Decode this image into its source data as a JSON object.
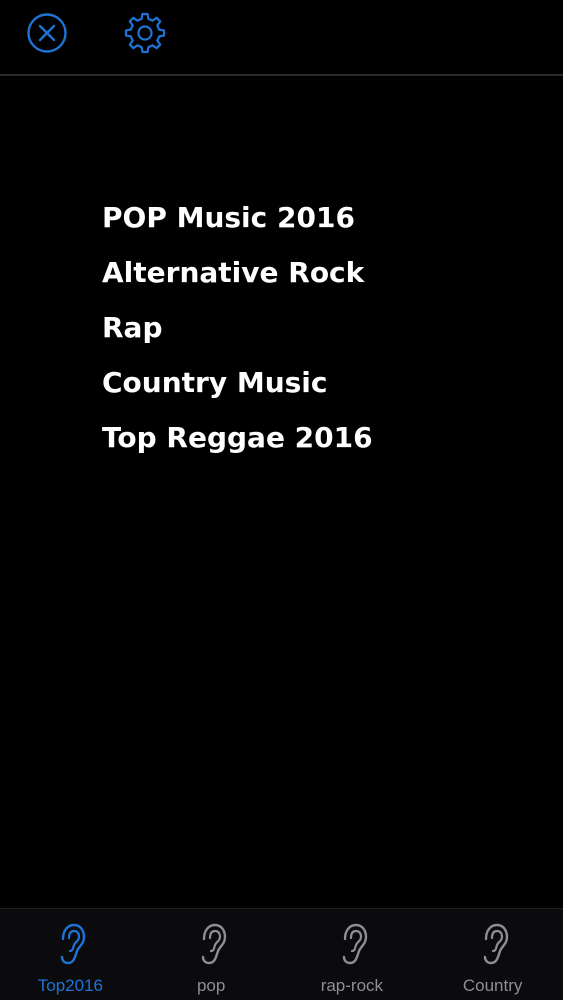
{
  "colors": {
    "accent": "#1e74d6",
    "background": "#000000",
    "text": "#ffffff",
    "inactive": "#8e8e93"
  },
  "header": {
    "close_icon": "close-circle-icon",
    "settings_icon": "gear-icon"
  },
  "genres": [
    {
      "label": "POP Music 2016"
    },
    {
      "label": "Alternative Rock"
    },
    {
      "label": "Rap"
    },
    {
      "label": "Country Music"
    },
    {
      "label": "Top Reggae 2016"
    }
  ],
  "tabs": [
    {
      "label": "Top2016",
      "icon": "ear-icon",
      "active": true
    },
    {
      "label": "pop",
      "icon": "ear-icon",
      "active": false
    },
    {
      "label": "rap-rock",
      "icon": "ear-icon",
      "active": false
    },
    {
      "label": "Country",
      "icon": "ear-icon",
      "active": false
    }
  ]
}
